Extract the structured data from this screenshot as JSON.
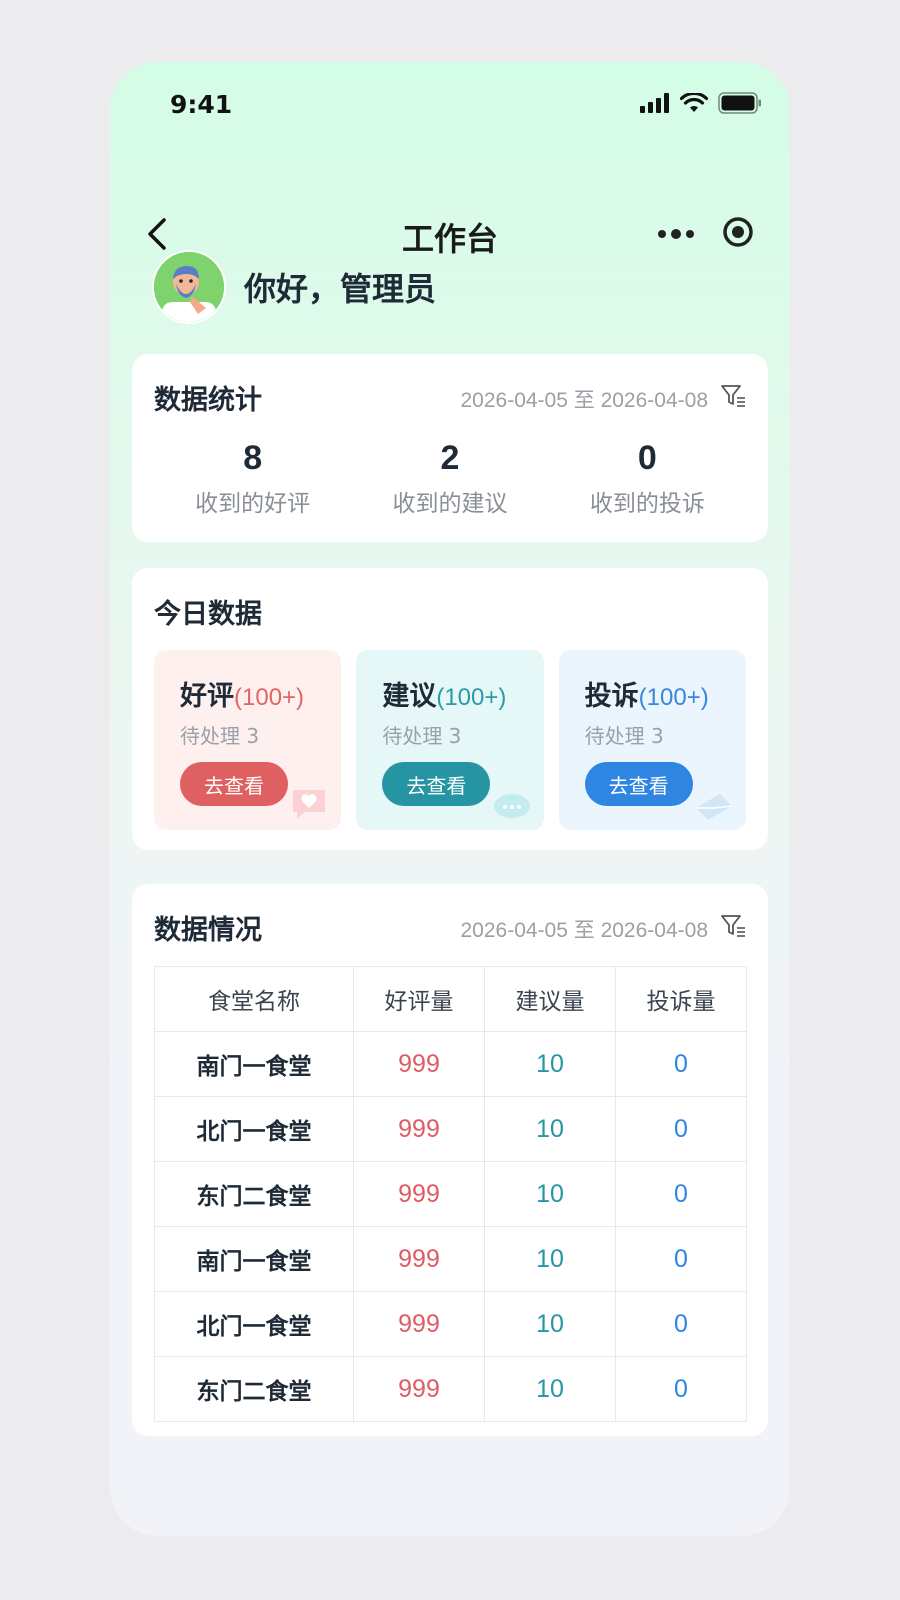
{
  "status_bar": {
    "time": "9:41"
  },
  "nav": {
    "title": "工作台"
  },
  "greeting": {
    "text": "你好，管理员"
  },
  "stats_card": {
    "title": "数据统计",
    "date_range": "2026-04-05 至 2026-04-08",
    "items": [
      {
        "value": "8",
        "label": "收到的好评"
      },
      {
        "value": "2",
        "label": "收到的建议"
      },
      {
        "value": "0",
        "label": "收到的投诉"
      }
    ]
  },
  "today_card": {
    "title": "今日数据",
    "tiles": [
      {
        "name": "好评",
        "count": "(100+)",
        "pending": "待处理 3",
        "button": "去查看",
        "color": "#df6060"
      },
      {
        "name": "建议",
        "count": "(100+)",
        "pending": "待处理 3",
        "button": "去查看",
        "color": "#2595a4"
      },
      {
        "name": "投诉",
        "count": "(100+)",
        "pending": "待处理 3",
        "button": "去查看",
        "color": "#2f85e2"
      }
    ]
  },
  "data_card": {
    "title": "数据情况",
    "date_range": "2026-04-05 至 2026-04-08",
    "columns": [
      "食堂名称",
      "好评量",
      "建议量",
      "投诉量"
    ],
    "rows": [
      {
        "name": "南门一食堂",
        "good": "999",
        "suggestion": "10",
        "complaint": "0"
      },
      {
        "name": "北门一食堂",
        "good": "999",
        "suggestion": "10",
        "complaint": "0"
      },
      {
        "name": "东门二食堂",
        "good": "999",
        "suggestion": "10",
        "complaint": "0"
      },
      {
        "name": "南门一食堂",
        "good": "999",
        "suggestion": "10",
        "complaint": "0"
      },
      {
        "name": "北门一食堂",
        "good": "999",
        "suggestion": "10",
        "complaint": "0"
      },
      {
        "name": "东门二食堂",
        "good": "999",
        "suggestion": "10",
        "complaint": "0"
      }
    ]
  },
  "icons": [
    "signal-icon",
    "wifi-icon",
    "battery-icon",
    "back-arrow-icon",
    "more-dots-icon",
    "target-icon",
    "filter-icon",
    "heart-chat-icon",
    "chat-bubble-icon",
    "envelope-icon"
  ]
}
